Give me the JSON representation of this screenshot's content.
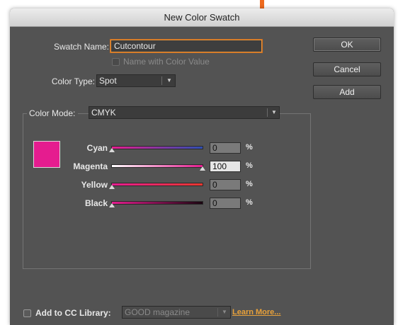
{
  "window": {
    "title": "New Color Swatch"
  },
  "swatch_name": {
    "label": "Swatch Name:",
    "value": "Cutcontour"
  },
  "name_with_color_value": {
    "label": "Name with Color Value",
    "checked": false,
    "enabled": false
  },
  "color_type": {
    "label": "Color Type:",
    "value": "Spot"
  },
  "color_mode": {
    "label": "Color Mode:",
    "value": "CMYK"
  },
  "buttons": {
    "ok": "OK",
    "cancel": "Cancel",
    "add": "Add"
  },
  "swatch_color": "#e51c8f",
  "sliders": [
    {
      "label": "Cyan",
      "value": "0",
      "unit": "%",
      "percent": 0,
      "gradient": [
        "#e51c8f",
        "#2f4fb2"
      ]
    },
    {
      "label": "Magenta",
      "value": "100",
      "unit": "%",
      "percent": 100,
      "gradient": [
        "#ffffff",
        "#e51c8f"
      ]
    },
    {
      "label": "Yellow",
      "value": "0",
      "unit": "%",
      "percent": 0,
      "gradient": [
        "#e51c8f",
        "#e8372f"
      ]
    },
    {
      "label": "Black",
      "value": "0",
      "unit": "%",
      "percent": 0,
      "gradient": [
        "#e51c8f",
        "#1a0510"
      ]
    }
  ],
  "cc_library": {
    "label": "Add to CC Library:",
    "checked": false,
    "library_value": "GOOD magazine",
    "learn_more": "Learn More..."
  },
  "colors": {
    "accent_orange": "#e8923a",
    "link": "#e8a13a"
  },
  "icons": {
    "arrow": "pointer-arrow-icon",
    "dropdown": "chevron-down-icon"
  }
}
